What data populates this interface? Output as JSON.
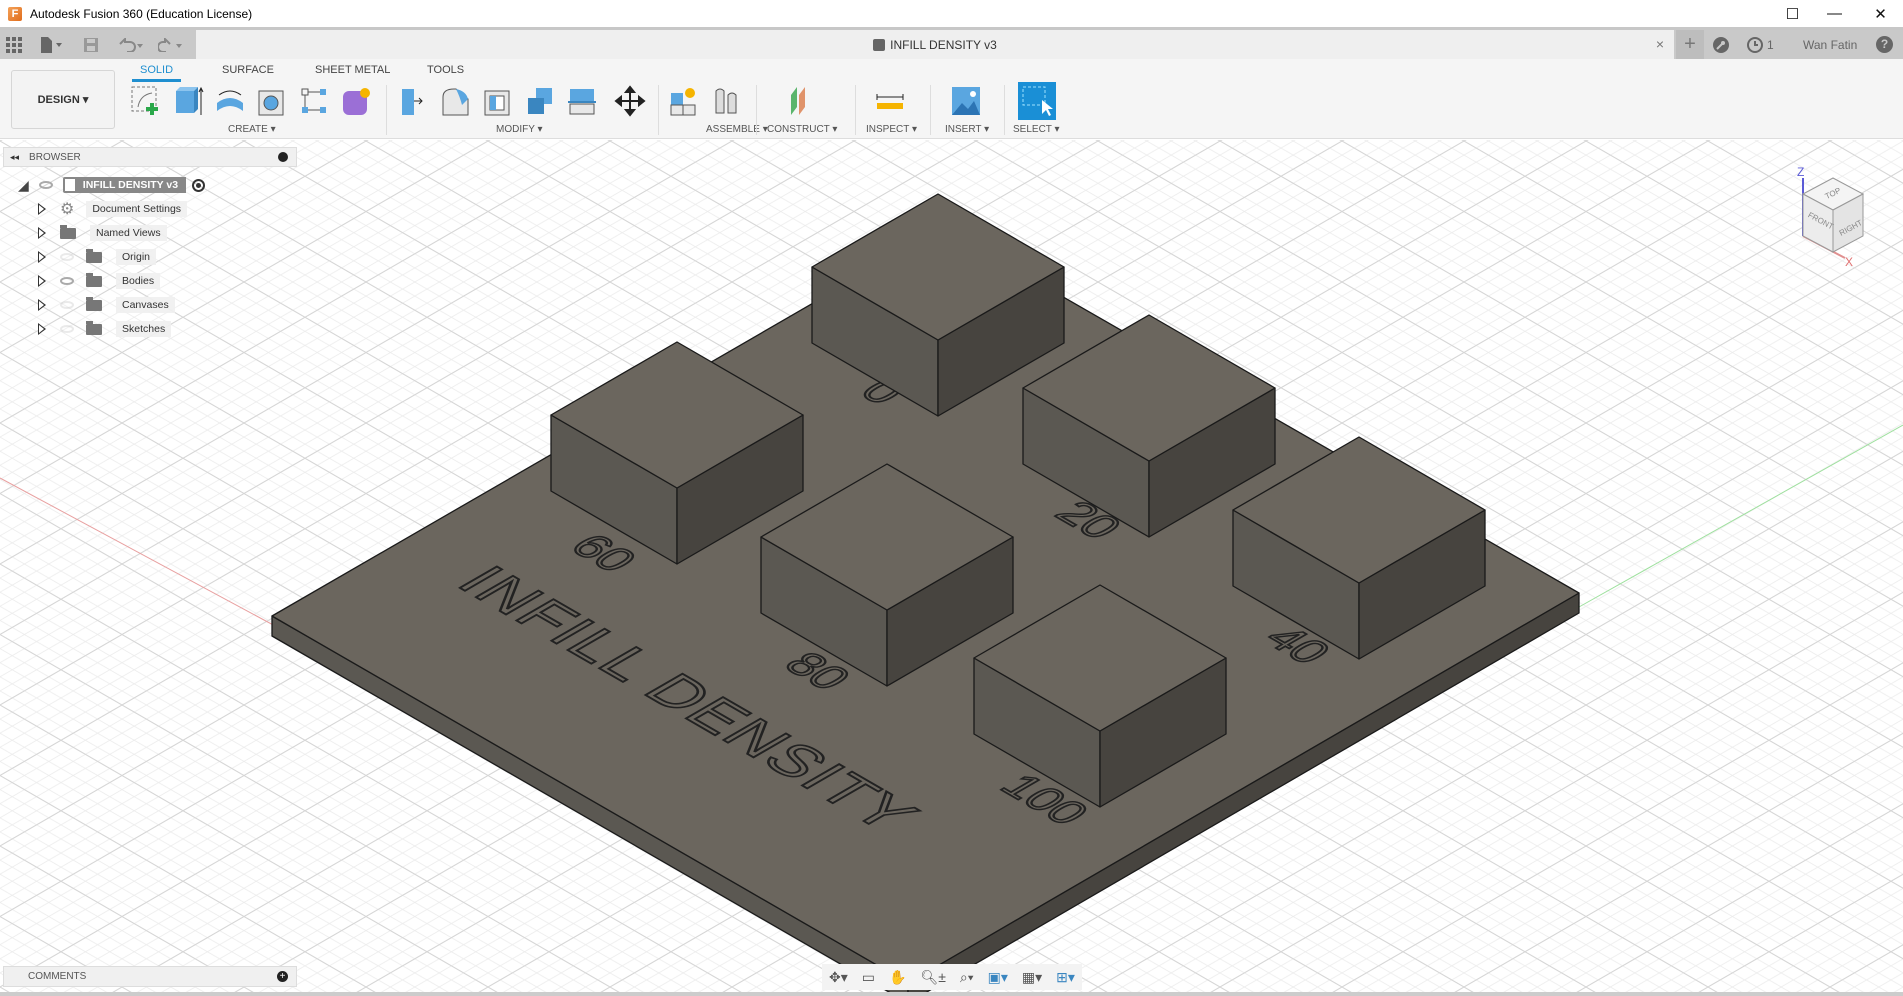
{
  "window": {
    "title": "Autodesk Fusion 360 (Education License)",
    "minimize_glyph": "—",
    "maximize_glyph": "☐",
    "close_glyph": "✕"
  },
  "quick_access": {
    "icons": [
      "grid-icon",
      "file-icon",
      "save-icon",
      "undo-icon",
      "redo-icon"
    ]
  },
  "document_tab": {
    "name": "INFILL DENSITY v3",
    "close_glyph": "×"
  },
  "header_right": {
    "new_tab_glyph": "+",
    "job_count": "1",
    "user_name": "Wan Fatin",
    "help_glyph": "?"
  },
  "ribbon": {
    "workspace_button": "DESIGN ▾",
    "tabs": [
      {
        "label": "SOLID",
        "active": true
      },
      {
        "label": "SURFACE",
        "active": false
      },
      {
        "label": "SHEET METAL",
        "active": false
      },
      {
        "label": "TOOLS",
        "active": false
      }
    ],
    "groups": [
      {
        "label": "CREATE ▾",
        "tools": [
          "create-sketch",
          "extrude",
          "revolve",
          "hole",
          "pattern",
          "create-form"
        ]
      },
      {
        "label": "MODIFY ▾",
        "tools": [
          "press-pull",
          "fillet",
          "shell",
          "combine",
          "split-face",
          "move"
        ]
      },
      {
        "label": "ASSEMBLE ▾",
        "tools": [
          "new-component",
          "joint"
        ]
      },
      {
        "label": "CONSTRUCT ▾",
        "tools": [
          "offset-plane"
        ]
      },
      {
        "label": "INSPECT ▾",
        "tools": [
          "measure"
        ]
      },
      {
        "label": "INSERT ▾",
        "tools": [
          "insert-image"
        ]
      },
      {
        "label": "SELECT ▾",
        "tools": [
          "select"
        ]
      }
    ]
  },
  "browser": {
    "title": "BROWSER",
    "root": "INFILL DENSITY v3",
    "items": [
      {
        "label": "Document Settings",
        "icon": "gear-icon",
        "visible": null
      },
      {
        "label": "Named Views",
        "icon": "folder-icon",
        "visible": null
      },
      {
        "label": "Origin",
        "icon": "folder-icon",
        "visible": false
      },
      {
        "label": "Bodies",
        "icon": "folder-icon",
        "visible": true
      },
      {
        "label": "Canvases",
        "icon": "folder-icon",
        "visible": false
      },
      {
        "label": "Sketches",
        "icon": "folder-icon",
        "visible": false
      }
    ]
  },
  "comments": {
    "title": "COMMENTS"
  },
  "viewcube": {
    "top": "TOP",
    "front": "FRONT",
    "right": "RIGHT",
    "axis_z": "Z",
    "axis_x": "X"
  },
  "model": {
    "engraved_title": "INFILL DENSITY",
    "sample_labels": [
      "0",
      "20",
      "40",
      "60",
      "80",
      "100"
    ],
    "colors": {
      "top": "#6b665e",
      "left": "#5b5852",
      "right": "#47443f",
      "edge": "#1a1a1a"
    }
  },
  "nav_bar": {
    "tools": [
      "orbit-icon",
      "look-at-icon",
      "pan-icon",
      "zoom-icon",
      "fit-icon",
      "display-settings-icon",
      "grid-settings-icon",
      "viewports-icon"
    ]
  }
}
